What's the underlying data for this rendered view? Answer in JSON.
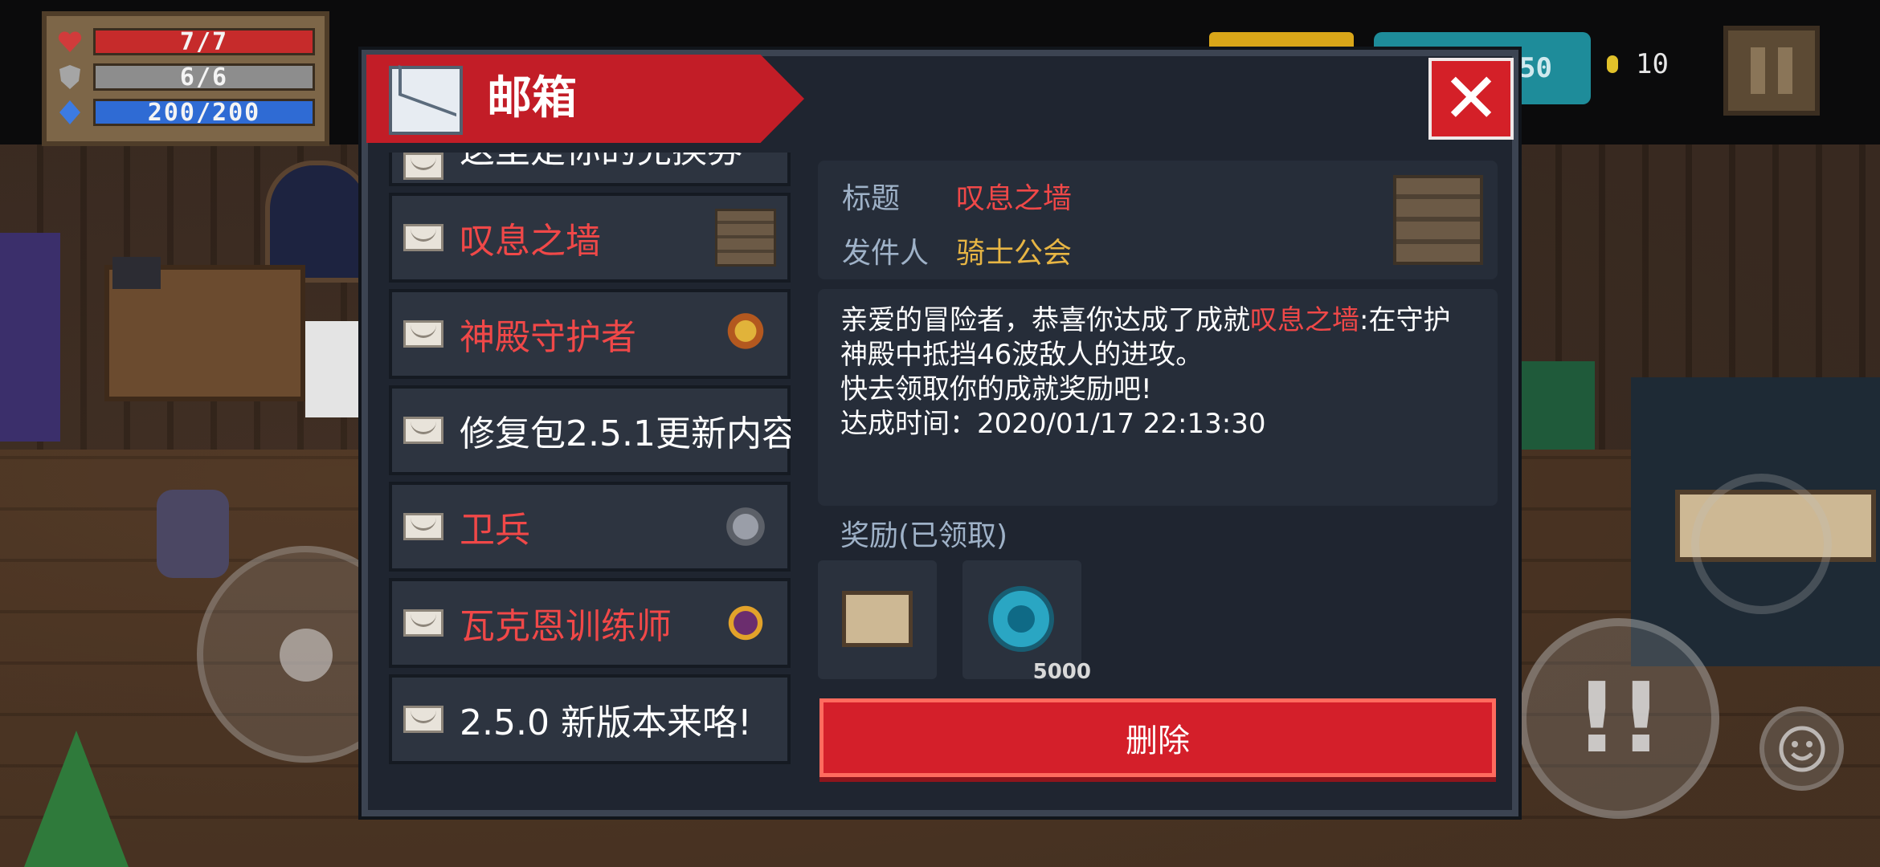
{
  "hud": {
    "hp": "7/7",
    "armor": "6/6",
    "energy": "200/200",
    "gems": "50",
    "coins": "10"
  },
  "mailbox": {
    "title": "邮箱",
    "close_label": "✕",
    "items": [
      {
        "label": "这里是你的兑换券",
        "color": "white"
      },
      {
        "label": "叹息之墙",
        "color": "red",
        "thumb": "wall-icon"
      },
      {
        "label": "神殿守护者",
        "color": "red",
        "thumb": "temple-guardian-icon"
      },
      {
        "label": "修复包2.5.1更新内容",
        "color": "white"
      },
      {
        "label": "卫兵",
        "color": "red",
        "thumb": "guard-helmet-icon"
      },
      {
        "label": "瓦克恩训练师",
        "color": "red",
        "thumb": "trainer-icon"
      },
      {
        "label": "2.5.0 新版本来咯!",
        "color": "white"
      }
    ],
    "detail": {
      "title_label": "标题",
      "title_value": "叹息之墙",
      "sender_label": "发件人",
      "sender_value": "骑士公会",
      "body_prefix": "亲爱的冒险者，恭喜你达成了成就",
      "body_achievement": "叹息之墙",
      "body_suffix": ":在守护神殿中抵挡46波敌人的进攻。",
      "body_line2": "快去领取你的成就奖励吧!",
      "body_line3": "达成时间：2020/01/17 22:13:30"
    },
    "rewards": {
      "title": "奖励(已领取)",
      "items": [
        {
          "icon": "scroll-icon",
          "qty": ""
        },
        {
          "icon": "gem-icon",
          "qty": "5000"
        }
      ]
    },
    "delete_label": "删除"
  },
  "colors": {
    "accent_red": "#c21d27",
    "panel": "#1f2530",
    "highlight_red": "#f04848",
    "sender_gold": "#e7b544"
  }
}
